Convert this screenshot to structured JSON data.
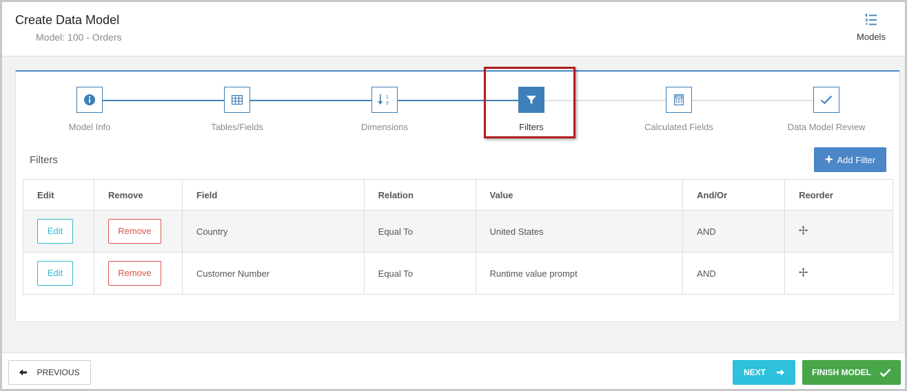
{
  "header": {
    "title": "Create Data Model",
    "subtitle": "Model: 100 - Orders",
    "models_label": "Models"
  },
  "stepper": {
    "steps": [
      {
        "label": "Model Info",
        "icon": "info-icon",
        "state": "complete"
      },
      {
        "label": "Tables/Fields",
        "icon": "table-grid-icon",
        "state": "complete"
      },
      {
        "label": "Dimensions",
        "icon": "sort-numeric-icon",
        "state": "complete"
      },
      {
        "label": "Filters",
        "icon": "filter-icon",
        "state": "active"
      },
      {
        "label": "Calculated Fields",
        "icon": "calculator-icon",
        "state": "pending"
      },
      {
        "label": "Data Model Review",
        "icon": "check-icon",
        "state": "pending"
      }
    ]
  },
  "filters": {
    "section_title": "Filters",
    "add_label": "Add Filter",
    "columns": [
      "Edit",
      "Remove",
      "Field",
      "Relation",
      "Value",
      "And/Or",
      "Reorder"
    ],
    "rows": [
      {
        "edit": "Edit",
        "remove": "Remove",
        "field": "Country",
        "relation": "Equal To",
        "value": "United States",
        "andor": "AND"
      },
      {
        "edit": "Edit",
        "remove": "Remove",
        "field": "Customer Number",
        "relation": "Equal To",
        "value": "Runtime value prompt",
        "andor": "AND"
      }
    ]
  },
  "footer": {
    "previous_label": "PREVIOUS",
    "next_label": "NEXT",
    "finish_label": "FINISH MODEL"
  },
  "colors": {
    "primary": "#3d7fb8",
    "next": "#2ec0dc",
    "finish": "#48a54a",
    "remove": "#d9534f",
    "edit": "#36b5d1",
    "highlight": "#b01c1c"
  }
}
